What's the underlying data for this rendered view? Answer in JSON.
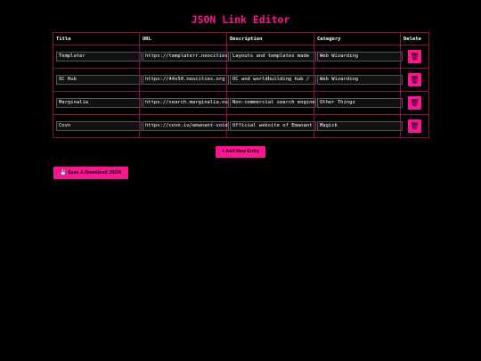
{
  "page": {
    "title": "JSON Link Editor"
  },
  "table": {
    "headers": [
      "Title",
      "URL",
      "Description",
      "Category",
      "Delete"
    ],
    "rows": [
      {
        "title": "Templater",
        "url": "https://templaterr.neocities.org",
        "description": "Layouts and templates made",
        "category": "Web Wizarding"
      },
      {
        "title": "OC Hub",
        "url": "https://44x50.neocities.org",
        "description": "OC and worldbuilding hub / ",
        "category": "Web Wizarding"
      },
      {
        "title": "Marginalia",
        "url": "https://search.marginalia.nu",
        "description": "Non-commercial search engine",
        "category": "Other Thingz"
      },
      {
        "title": "Covn",
        "url": "https://covn.io/emanant-void",
        "description": "Official website of Emanant",
        "category": "Magick"
      }
    ],
    "delete_icon": "trash-icon",
    "delete_glyph": "🗑"
  },
  "actions": {
    "add_label": "+ Add New Entry",
    "save_icon": "floppy-disk-icon",
    "save_glyph": "💾",
    "save_label": "Save & Download JSON"
  },
  "colors": {
    "accent": "#ff1493",
    "background": "#000000",
    "border": "#8a1050"
  }
}
